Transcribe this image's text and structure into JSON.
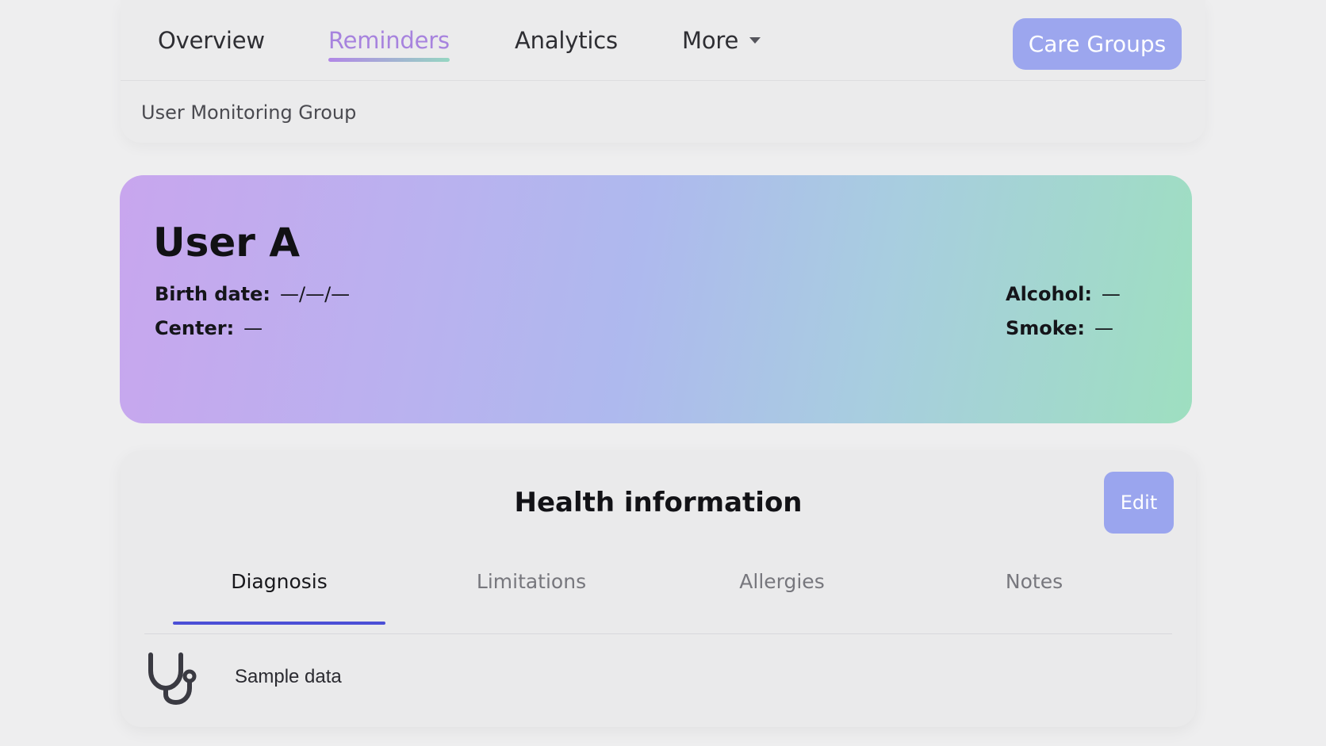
{
  "nav": {
    "tabs": [
      {
        "label": "Overview"
      },
      {
        "label": "Reminders",
        "active": true
      },
      {
        "label": "Analytics"
      },
      {
        "label": "More"
      }
    ],
    "care_groups_button": "Care Groups",
    "group_label": "User Monitoring Group"
  },
  "profile": {
    "name": "User A",
    "birth_date": {
      "label": "Birth date:",
      "value": "—/—/—"
    },
    "center": {
      "label": "Center:",
      "value": "—"
    },
    "alcohol": {
      "label": "Alcohol:",
      "value": "—"
    },
    "smoke": {
      "label": "Smoke:",
      "value": "—"
    }
  },
  "health": {
    "title": "Health information",
    "edit_button": "Edit",
    "tabs": [
      {
        "label": "Diagnosis",
        "active": true
      },
      {
        "label": "Limitations"
      },
      {
        "label": "Allergies"
      },
      {
        "label": "Notes"
      }
    ],
    "entries": [
      {
        "icon": "stethoscope-icon",
        "text": "Sample data"
      }
    ]
  },
  "colors": {
    "accent_tab": "#a783de",
    "button": "#9ca6ee",
    "tab_indicator": "#4b4fd6",
    "gradient": [
      "#c8a6ee",
      "#aeb9ee",
      "#9edfc0"
    ]
  }
}
